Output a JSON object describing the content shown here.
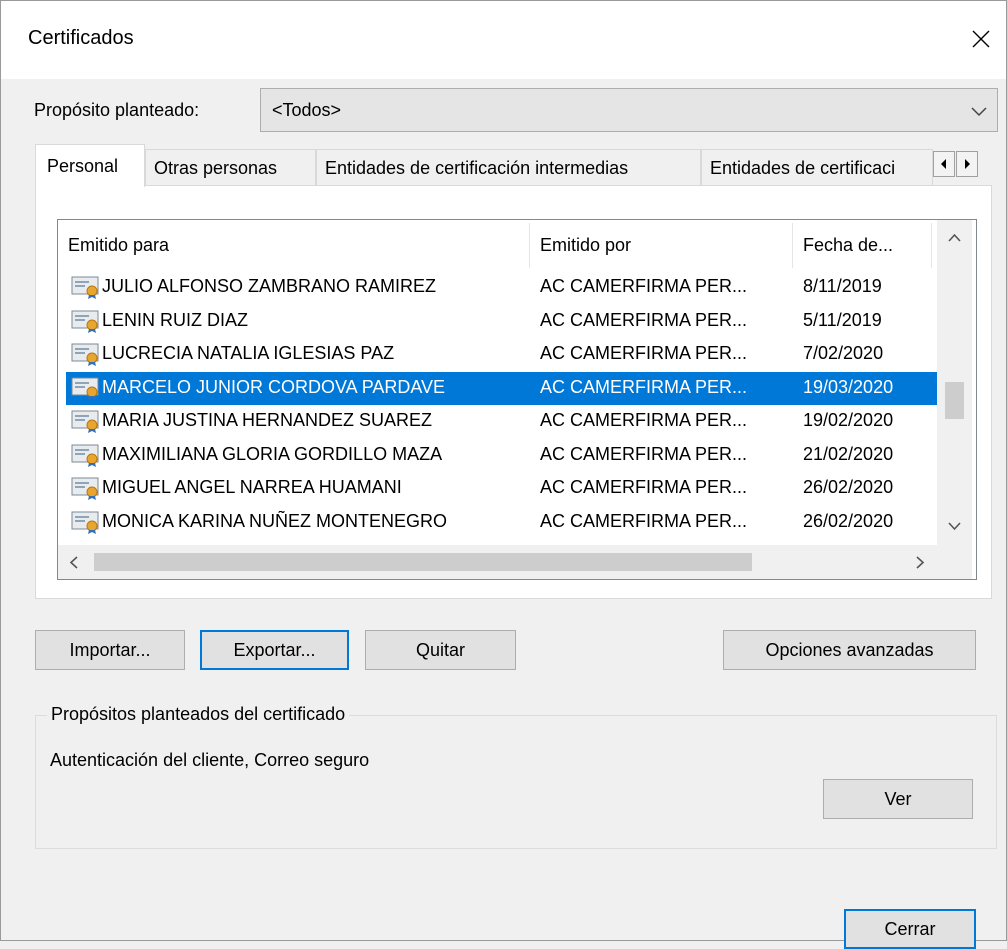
{
  "window": {
    "title": "Certificados"
  },
  "purpose": {
    "label": "Propósito planteado:",
    "value": "<Todos>"
  },
  "tabs": [
    {
      "label": "Personal"
    },
    {
      "label": "Otras personas"
    },
    {
      "label": "Entidades de certificación intermedias"
    },
    {
      "label": "Entidades de certificaci"
    }
  ],
  "list": {
    "columns": [
      "Emitido para",
      "Emitido por",
      "Fecha de..."
    ],
    "rows": [
      {
        "issued_to": "JULIO ALFONSO ZAMBRANO RAMIREZ",
        "issued_by": "AC CAMERFIRMA PER...",
        "date": "8/11/2019"
      },
      {
        "issued_to": "LENIN RUIZ DIAZ",
        "issued_by": "AC CAMERFIRMA PER...",
        "date": "5/11/2019"
      },
      {
        "issued_to": "LUCRECIA NATALIA IGLESIAS PAZ",
        "issued_by": "AC CAMERFIRMA PER...",
        "date": "7/02/2020"
      },
      {
        "issued_to": "MARCELO JUNIOR CORDOVA PARDAVE",
        "issued_by": "AC CAMERFIRMA PER...",
        "date": "19/03/2020"
      },
      {
        "issued_to": "MARIA JUSTINA HERNANDEZ SUAREZ",
        "issued_by": "AC CAMERFIRMA PER...",
        "date": "19/02/2020"
      },
      {
        "issued_to": "MAXIMILIANA GLORIA GORDILLO MAZA",
        "issued_by": "AC CAMERFIRMA PER...",
        "date": "21/02/2020"
      },
      {
        "issued_to": "MIGUEL ANGEL NARREA HUAMANI",
        "issued_by": "AC CAMERFIRMA PER...",
        "date": "26/02/2020"
      },
      {
        "issued_to": "MONICA KARINA NUÑEZ MONTENEGRO",
        "issued_by": "AC CAMERFIRMA PER...",
        "date": "26/02/2020"
      }
    ]
  },
  "buttons": {
    "import": "Importar...",
    "export": "Exportar...",
    "remove": "Quitar",
    "advanced": "Opciones avanzadas",
    "view": "Ver",
    "close": "Cerrar"
  },
  "purposes_group": {
    "legend": "Propósitos planteados del certificado",
    "text": "Autenticación del cliente, Correo seguro"
  },
  "colors": {
    "selection": "#0078d7",
    "focus_border": "#0078d7",
    "button_face": "#e1e1e1"
  }
}
